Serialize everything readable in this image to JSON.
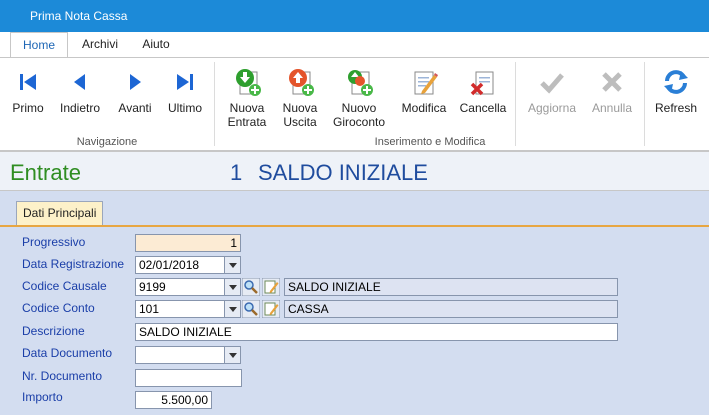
{
  "window": {
    "title": "Prima Nota Cassa"
  },
  "menu": {
    "tabs": [
      {
        "label": "Home"
      },
      {
        "label": "Archivi"
      },
      {
        "label": "Aiuto"
      }
    ]
  },
  "ribbon": {
    "nav_group": "Navigazione",
    "edit_group": "Inserimento e Modifica",
    "buttons": {
      "primo": "Primo",
      "indietro": "Indietro",
      "avanti": "Avanti",
      "ultimo": "Ultimo",
      "nuova_entrata_1": "Nuova",
      "nuova_entrata_2": "Entrata",
      "nuova_uscita_1": "Nuova",
      "nuova_uscita_2": "Uscita",
      "nuovo_giroconto_1": "Nuovo",
      "nuovo_giroconto_2": "Giroconto",
      "modifica": "Modifica",
      "cancella": "Cancella",
      "aggiorna": "Aggiorna",
      "annulla": "Annulla",
      "refresh": "Refresh"
    }
  },
  "header": {
    "mode": "Entrate",
    "number": "1",
    "description": "SALDO INIZIALE"
  },
  "form": {
    "tab_label": "Dati Principali",
    "progressivo": {
      "label": "Progressivo",
      "value": "1"
    },
    "data_registrazione": {
      "label": "Data Registrazione",
      "value": "02/01/2018"
    },
    "codice_causale": {
      "label": "Codice Causale",
      "value": "9199",
      "description": "SALDO INIZIALE"
    },
    "codice_conto": {
      "label": "Codice Conto",
      "value": "101",
      "description": "CASSA"
    },
    "descrizione": {
      "label": "Descrizione",
      "value": "SALDO INIZIALE"
    },
    "data_documento": {
      "label": "Data Documento",
      "value": ""
    },
    "nr_documento": {
      "label": "Nr. Documento",
      "value": ""
    },
    "importo": {
      "label": "Importo",
      "value": "5.500,00"
    }
  },
  "colors": {
    "titlebar": "#1c8ad8",
    "mode_text": "#2f8d22",
    "header_text": "#1f4c9e",
    "label_text": "#1a3ea8",
    "panel_bg": "#d3ddf0",
    "tab_accent": "#e7a642"
  },
  "icons": {
    "primo": "first-record-icon",
    "indietro": "previous-record-icon",
    "avanti": "next-record-icon",
    "ultimo": "last-record-icon",
    "nuova_entrata": "document-add-green-icon",
    "nuova_uscita": "document-add-red-icon",
    "nuovo_giroconto": "document-exchange-icon",
    "modifica": "edit-document-icon",
    "cancella": "delete-document-icon",
    "aggiorna": "checkmark-icon",
    "annulla": "cancel-x-icon",
    "refresh": "refresh-icon",
    "lookup": "magnifier-icon",
    "edit_lookup": "pencil-note-icon"
  }
}
